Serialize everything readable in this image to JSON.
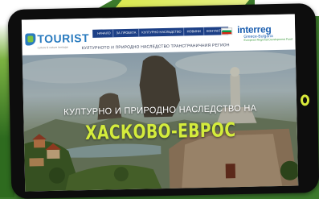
{
  "site": {
    "logo_text": "TOURIST",
    "logo_subtext": "culture & nature heritage",
    "tagline": "КУЛТУРНОТО И ПРИРОДНО НАСЛЕДСТВО ТРАНСГРАНИЧНИЯ РЕГИОН",
    "nav": [
      {
        "label": "НАЧАЛО"
      },
      {
        "label": "ЗА ПРОЕКТА"
      },
      {
        "label": "КУЛТУРНО НАСЛЕДСТВО"
      },
      {
        "label": "НОВИНИ"
      },
      {
        "label": "КОНТАКТИ"
      }
    ],
    "interreg": {
      "title": "interreg",
      "line1": "Greece-Bulgaria",
      "line2": "European Regional Development Fund"
    },
    "language_flag": "bg-flag-icon"
  },
  "hero": {
    "subtitle": "КУЛТУРНО И ПРИРОДНО НАСЛЕДСТВО НА",
    "title": "ХАСКОВО-ЕВРОС"
  },
  "colors": {
    "accent_green": "#d4ec3c",
    "nav_blue": "#1c3f86",
    "logo_blue": "#2a7bbf",
    "frame": "#0d0d0d"
  }
}
